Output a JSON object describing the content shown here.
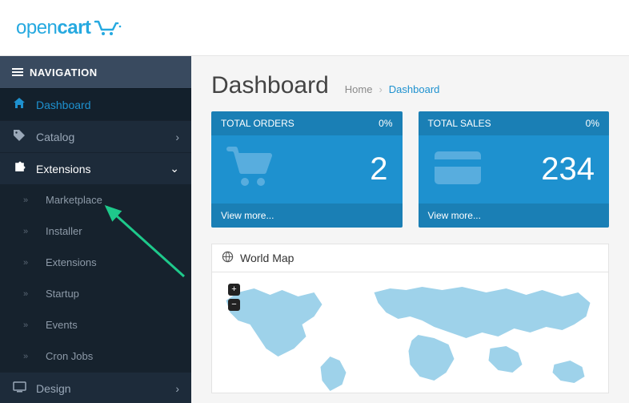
{
  "logo": {
    "open": "open",
    "cart": "cart"
  },
  "nav": {
    "title": "NAVIGATION",
    "items": [
      {
        "label": "Dashboard"
      },
      {
        "label": "Catalog"
      },
      {
        "label": "Extensions",
        "sub": [
          {
            "label": "Marketplace"
          },
          {
            "label": "Installer"
          },
          {
            "label": "Extensions"
          },
          {
            "label": "Startup"
          },
          {
            "label": "Events"
          },
          {
            "label": "Cron Jobs"
          }
        ]
      },
      {
        "label": "Design"
      }
    ]
  },
  "page": {
    "title": "Dashboard",
    "crumb_home": "Home",
    "crumb_current": "Dashboard"
  },
  "tiles": [
    {
      "title": "TOTAL ORDERS",
      "pct": "0%",
      "value": "2",
      "more": "View more..."
    },
    {
      "title": "TOTAL SALES",
      "pct": "0%",
      "value": "234",
      "more": "View more..."
    }
  ],
  "worldmap": {
    "title": "World Map",
    "plus": "+",
    "minus": "−"
  }
}
